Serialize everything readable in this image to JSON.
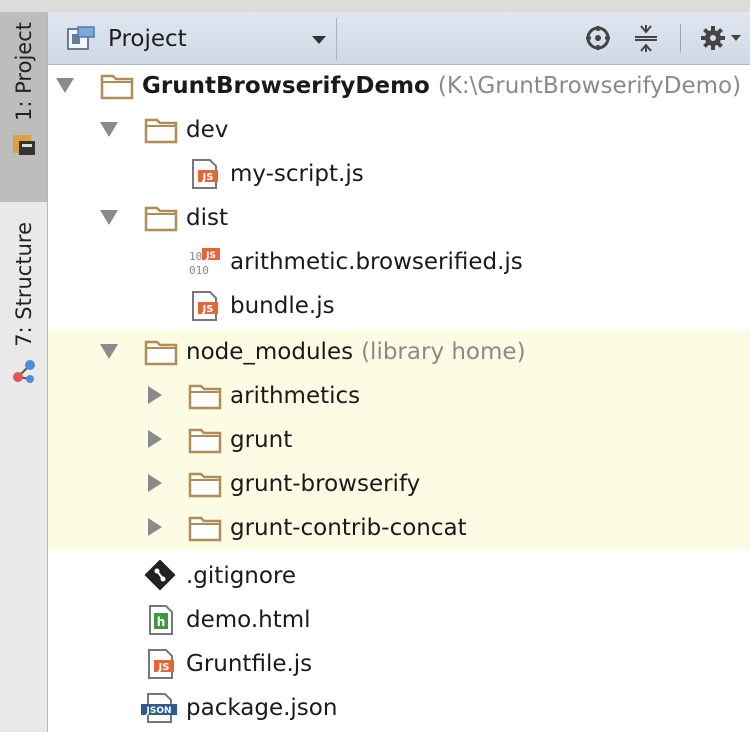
{
  "header": {
    "view_label": "Project",
    "locate_icon": "crosshair-icon",
    "collapse_icon": "collapse-all-icon",
    "settings_icon": "gear-icon"
  },
  "stripe": {
    "tabs": [
      {
        "label": "1: Project",
        "icon": "project-icon"
      },
      {
        "label": "7: Structure",
        "icon": "structure-icon"
      }
    ]
  },
  "tree": {
    "root": {
      "label": "GruntBrowserifyDemo",
      "hint": "(K:\\GruntBrowserifyDemo)"
    },
    "dev": {
      "label": "dev"
    },
    "dev_file": {
      "label": "my-script.js"
    },
    "dist": {
      "label": "dist"
    },
    "dist_file1": {
      "label": "arithmetic.browserified.js"
    },
    "dist_file2": {
      "label": "bundle.js"
    },
    "node_modules": {
      "label": "node_modules",
      "hint": "(library home)"
    },
    "nm1": {
      "label": "arithmetics"
    },
    "nm2": {
      "label": "grunt"
    },
    "nm3": {
      "label": "grunt-browserify"
    },
    "nm4": {
      "label": "grunt-contrib-concat"
    },
    "f1": {
      "label": ".gitignore"
    },
    "f2": {
      "label": "demo.html"
    },
    "f3": {
      "label": "Gruntfile.js"
    },
    "f4": {
      "label": "package.json"
    }
  },
  "colors": {
    "folder": "#b08d57",
    "library_bg": "#fcfbe3",
    "js_badge": "#e2683c",
    "header_bg": "#d6dee9"
  }
}
